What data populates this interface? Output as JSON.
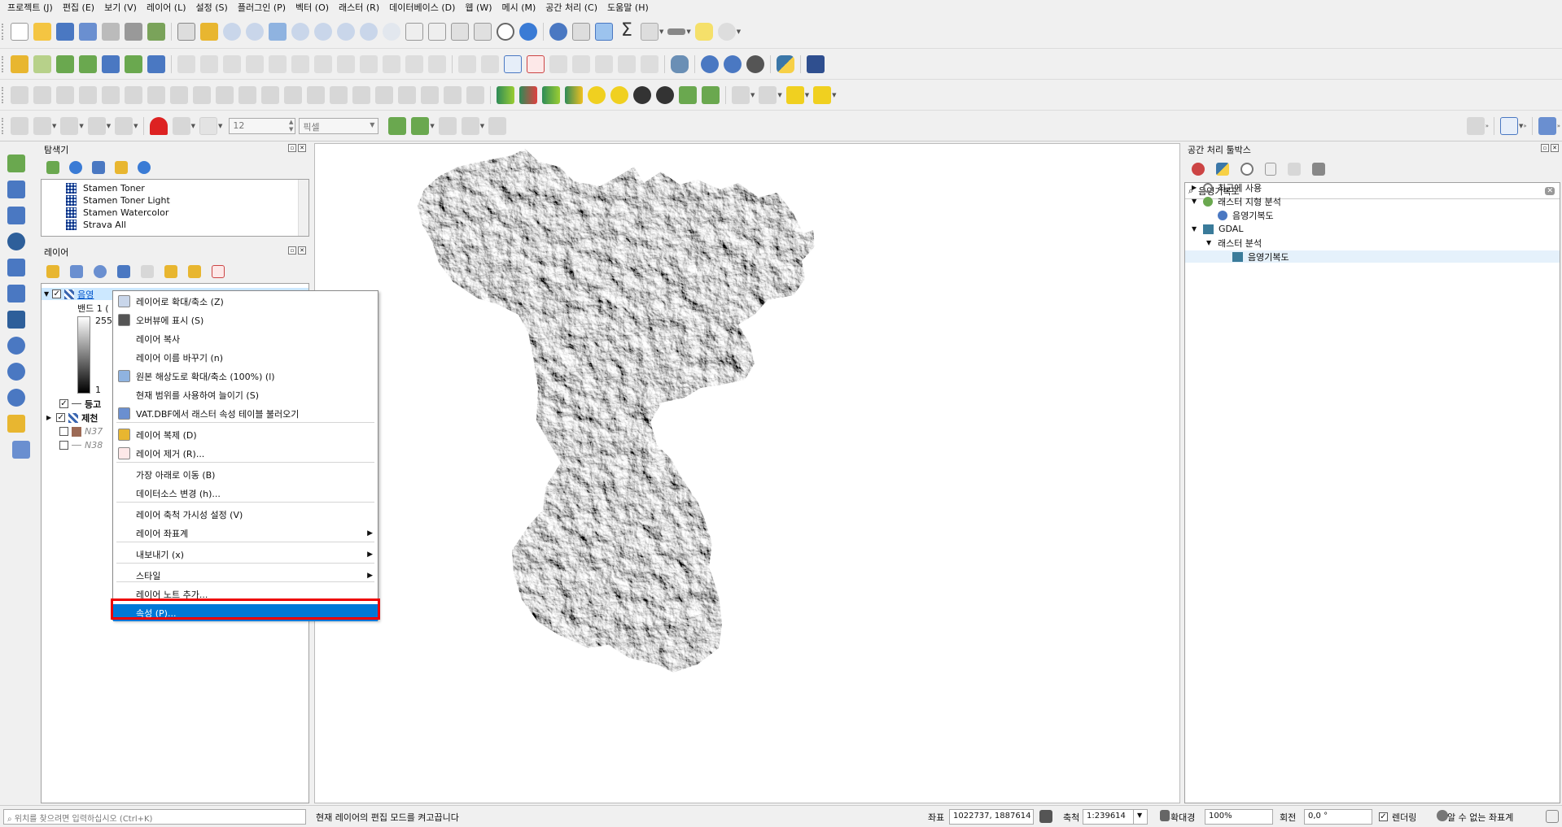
{
  "menubar": [
    "프로젝트 (J)",
    "편집 (E)",
    "보기 (V)",
    "레이어 (L)",
    "설정 (S)",
    "플러그인 (P)",
    "벡터 (O)",
    "래스터 (R)",
    "데이터베이스 (D)",
    "웹 (W)",
    "메시 (M)",
    "공간 처리 (C)",
    "도움말 (H)"
  ],
  "toolbar": {
    "snapping_value": "12",
    "snapping_unit": "픽셀"
  },
  "browser_panel": {
    "title": "탐색기",
    "items": [
      "Stamen Toner",
      "Stamen Toner Light",
      "Stamen Watercolor",
      "Strava All"
    ]
  },
  "layers_panel": {
    "title": "레이어",
    "selected_layer": "음영",
    "band_label": "밴드 1 (",
    "legend_max": "255",
    "legend_min": "1",
    "other_layers": [
      "등고",
      "제천",
      "N37",
      "N38"
    ]
  },
  "context_menu": [
    {
      "label": "레이어로 확대/축소 (Z)",
      "icon": "zoom-to-layer-icon"
    },
    {
      "label": "오버뷰에 표시 (S)",
      "icon": "overview-icon"
    },
    {
      "label": "레이어 복사",
      "icon": ""
    },
    {
      "label": "레이어 이름 바꾸기 (n)",
      "icon": ""
    },
    {
      "label": "원본 해상도로 확대/축소 (100%) (l)",
      "icon": "zoom-native-icon"
    },
    {
      "label": "현재 범위를 사용하여 늘이기 (S)",
      "icon": ""
    },
    {
      "label": "VAT.DBF에서 래스터 속성 테이블 불러오기",
      "icon": "attribute-table-icon"
    },
    {
      "label": "레이어 복제 (D)",
      "icon": "duplicate-icon"
    },
    {
      "label": "레이어 제거 (R)...",
      "icon": "remove-layer-icon"
    },
    {
      "label": "가장 아래로 이동 (B)",
      "icon": ""
    },
    {
      "label": "데이터소스 변경 (h)...",
      "icon": ""
    },
    {
      "label": "레이어 축척 가시성 설정 (V)",
      "icon": ""
    },
    {
      "label": "레이어 좌표계",
      "icon": "",
      "submenu": true
    },
    {
      "label": "내보내기 (x)",
      "icon": "",
      "submenu": true
    },
    {
      "label": "스타일",
      "icon": "",
      "submenu": true
    },
    {
      "label": "레이어 노트 추가...",
      "icon": ""
    },
    {
      "label": "속성 (P)...",
      "icon": "",
      "highlighted": true
    }
  ],
  "processing_panel": {
    "title": "공간 처리 툴박스",
    "search_value": "음영기복도",
    "tree": [
      {
        "label": "최근에 사용",
        "level": 0
      },
      {
        "label": "래스터 지형 분석",
        "level": 0
      },
      {
        "label": "음영기복도",
        "level": 1
      },
      {
        "label": "GDAL",
        "level": 0
      },
      {
        "label": "래스터 분석",
        "level": 1
      },
      {
        "label": "음영기복도",
        "level": 2
      }
    ]
  },
  "status_bar": {
    "locator_placeholder": "위치를 찾으려면 입력하십시오 (Ctrl+K)",
    "message": "현재 레이어의 편집 모드를 켜고끕니다",
    "coord_label": "좌표",
    "coord_value": "1022737, 1887614",
    "scale_label": "축척",
    "scale_value": "1:239614",
    "magnifier_label": "확대경",
    "magnifier_value": "100%",
    "rotation_label": "회전",
    "rotation_value": "0,0 °",
    "render_label": "렌더링",
    "crs_label": "알 수 없는 좌표계"
  },
  "colors": {
    "highlight": "#0078d7",
    "annotation_box": "#e00000",
    "selection": "#cce8ff"
  }
}
